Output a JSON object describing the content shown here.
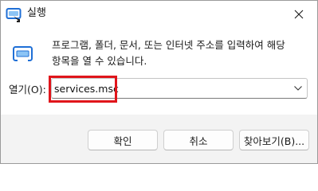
{
  "window": {
    "title": "실행",
    "close_label": "✕"
  },
  "dialog": {
    "description": "프로그램, 폴더, 문서, 또는 인터넷 주소를 입력하여 해당 항목을 열 수 있습니다.",
    "open_label": "열기(O):",
    "open_value": "services.msc"
  },
  "buttons": {
    "ok": "확인",
    "cancel": "취소",
    "browse": "찾아보기(B)..."
  },
  "colors": {
    "highlight": "#e0151b",
    "accent": "#0a64c8"
  }
}
